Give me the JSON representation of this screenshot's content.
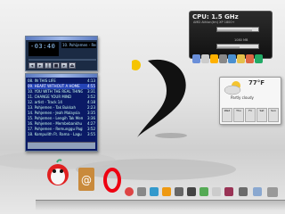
{
  "winamp": {
    "time_display": "-03:40",
    "track_title": "10. Pohijemen - Remembrance",
    "playlist": [
      {
        "num": "08.",
        "title": "IN THIS LIFE",
        "time": "4:13"
      },
      {
        "num": "09.",
        "title": "HEART WITHOUT A HOME",
        "time": "4:55"
      },
      {
        "num": "10.",
        "title": "YOU WITH THE REAL THING",
        "time": "3:31"
      },
      {
        "num": "11.",
        "title": "CHANGE YOUR MIND",
        "time": "3:52"
      },
      {
        "num": "12.",
        "title": "artist - Track 14",
        "time": "4:18"
      },
      {
        "num": "13.",
        "title": "Pohjemen - Tak Bukkah",
        "time": "2:23"
      },
      {
        "num": "14.",
        "title": "Pohjemen - Jeah Malaysia",
        "time": "3:35"
      },
      {
        "num": "15.",
        "title": "Pohjemen - Lengih Tak Memberaya",
        "time": "3:36"
      },
      {
        "num": "16.",
        "title": "Pohjemen - Membebankhu",
        "time": "4:27"
      },
      {
        "num": "17.",
        "title": "Pohjemen - Remunggu Pagi",
        "time": "3:52"
      },
      {
        "num": "18.",
        "title": "Kompulith Ft. Rama - Lagu Rindu",
        "time": "3:55"
      }
    ],
    "selected_index": 1
  },
  "cpu_widget": {
    "title": "CPU: 1.5 GHz",
    "subtitle": "AMD Athlon(tm) XP 1800+",
    "cpu_load_fraction": 0.85,
    "ram_fraction": 0.55,
    "mem_label": "1080 MB"
  },
  "weather": {
    "temp": "77°F",
    "condition": "Partly cloudy",
    "days": [
      "Wed",
      "Thu",
      "Fri",
      "Sat",
      "Sun"
    ]
  },
  "colors": {
    "winamp_frame": "#1b2b44",
    "playlist_bg": "#0b1a66",
    "playlist_selected": "#2645b8",
    "cpu_bg": "#1a1a1a",
    "logo_yellow": "#f5c400"
  }
}
